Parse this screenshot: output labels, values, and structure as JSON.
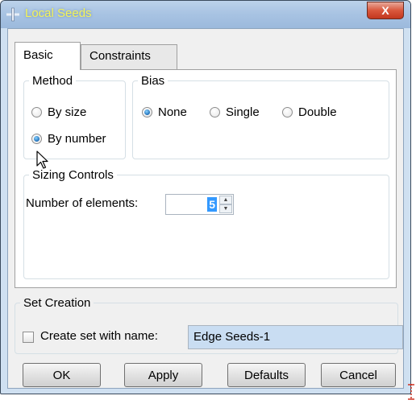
{
  "window": {
    "title": "Local Seeds",
    "close_label": "X"
  },
  "tabs": [
    {
      "label": "Basic"
    },
    {
      "label": "Constraints"
    }
  ],
  "method": {
    "legend": "Method",
    "options": [
      {
        "label": "By size",
        "selected": false
      },
      {
        "label": "By number",
        "selected": true
      }
    ]
  },
  "bias": {
    "legend": "Bias",
    "options": [
      {
        "label": "None",
        "selected": true
      },
      {
        "label": "Single",
        "selected": false
      },
      {
        "label": "Double",
        "selected": false
      }
    ]
  },
  "sizing": {
    "legend": "Sizing Controls",
    "label": "Number of elements:",
    "value": "5"
  },
  "set_creation": {
    "legend": "Set Creation",
    "checkbox_label": "Create set with name:",
    "checked": false,
    "name_value": "Edge Seeds-1"
  },
  "buttons": {
    "ok": "OK",
    "apply": "Apply",
    "defaults": "Defaults",
    "cancel": "Cancel"
  },
  "icons": [
    "abaqus-cross-icon",
    "close-icon",
    "mouse-cursor-icon",
    "spin-up-icon",
    "spin-down-icon"
  ],
  "colors": {
    "title_text": "#f3f35a",
    "selection": "#3399ff",
    "field_bg": "#c9ddf2"
  }
}
